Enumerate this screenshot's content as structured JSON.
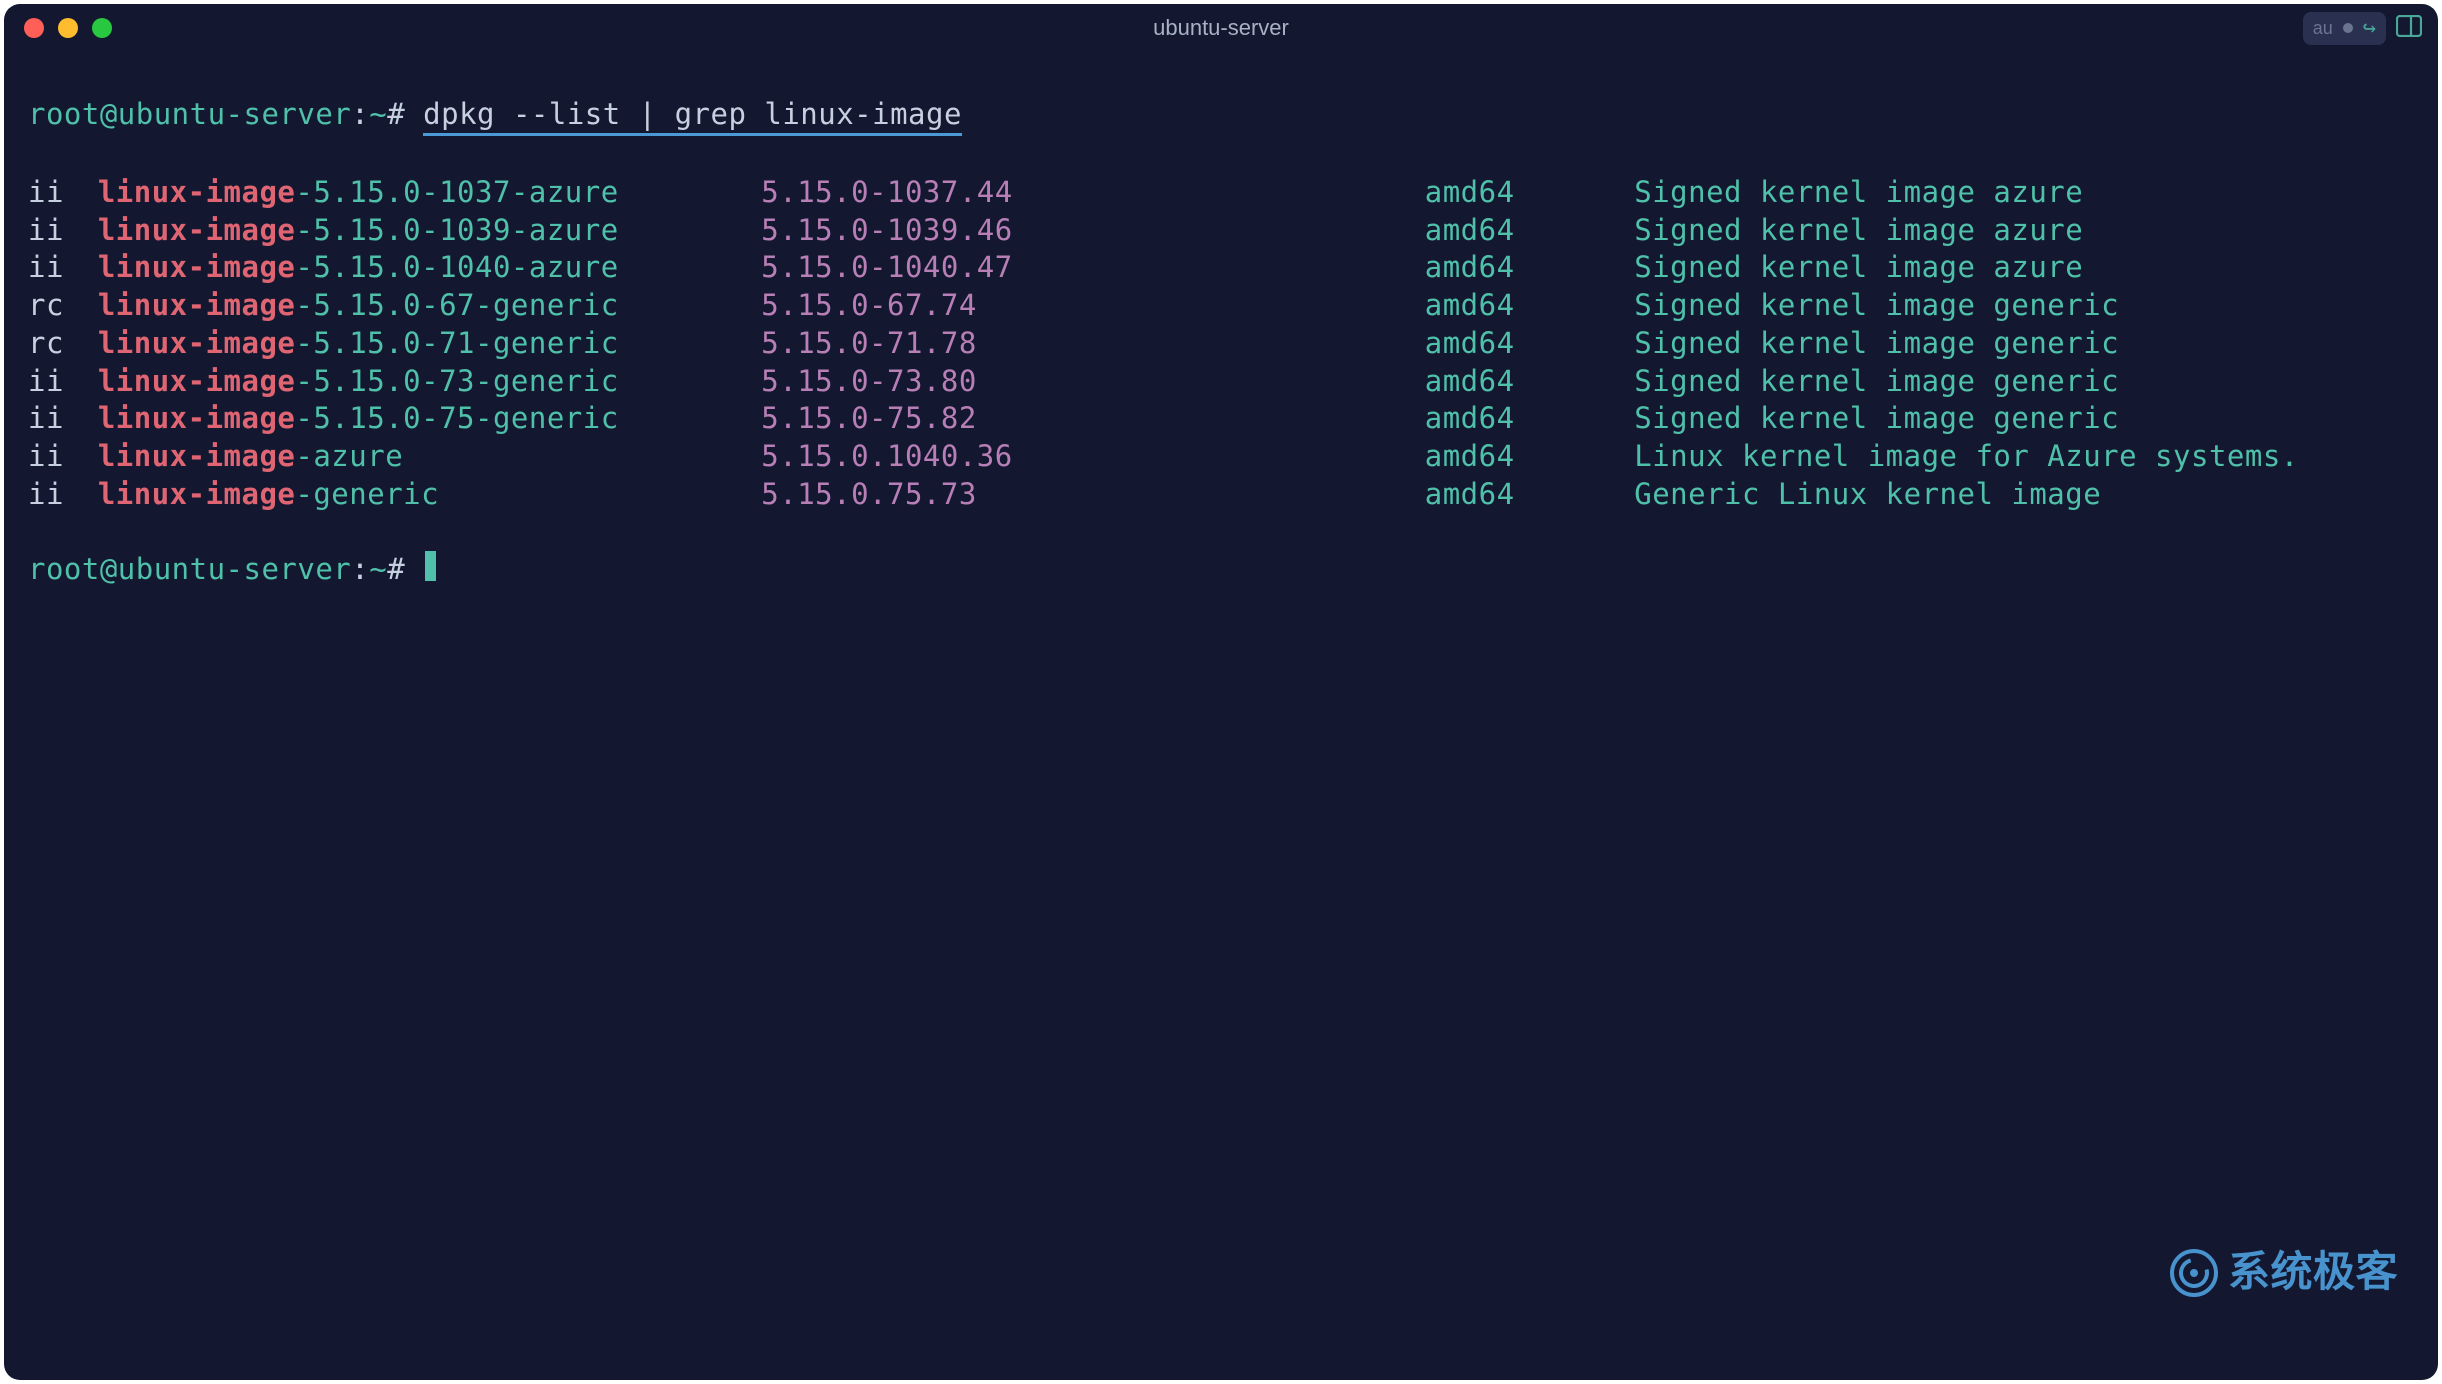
{
  "window": {
    "title": "ubuntu-server",
    "titlebar_right_label": "au"
  },
  "prompt": {
    "user_host": "root@ubuntu-server",
    "sep": ":",
    "path": "~",
    "end": "#"
  },
  "command": {
    "text": "dpkg --list | grep linux-image"
  },
  "rows": [
    {
      "status": "ii",
      "match": "linux-image",
      "rest": "-5.15.0-1037-azure",
      "version": "5.15.0-1037.44",
      "arch": "amd64",
      "desc": "Signed kernel image azure"
    },
    {
      "status": "ii",
      "match": "linux-image",
      "rest": "-5.15.0-1039-azure",
      "version": "5.15.0-1039.46",
      "arch": "amd64",
      "desc": "Signed kernel image azure"
    },
    {
      "status": "ii",
      "match": "linux-image",
      "rest": "-5.15.0-1040-azure",
      "version": "5.15.0-1040.47",
      "arch": "amd64",
      "desc": "Signed kernel image azure"
    },
    {
      "status": "rc",
      "match": "linux-image",
      "rest": "-5.15.0-67-generic",
      "version": "5.15.0-67.74",
      "arch": "amd64",
      "desc": "Signed kernel image generic"
    },
    {
      "status": "rc",
      "match": "linux-image",
      "rest": "-5.15.0-71-generic",
      "version": "5.15.0-71.78",
      "arch": "amd64",
      "desc": "Signed kernel image generic"
    },
    {
      "status": "ii",
      "match": "linux-image",
      "rest": "-5.15.0-73-generic",
      "version": "5.15.0-73.80",
      "arch": "amd64",
      "desc": "Signed kernel image generic"
    },
    {
      "status": "ii",
      "match": "linux-image",
      "rest": "-5.15.0-75-generic",
      "version": "5.15.0-75.82",
      "arch": "amd64",
      "desc": "Signed kernel image generic"
    },
    {
      "status": "ii",
      "match": "linux-image",
      "rest": "-azure",
      "version": "5.15.0.1040.36",
      "arch": "amd64",
      "desc": "Linux kernel image for Azure systems."
    },
    {
      "status": "ii",
      "match": "linux-image",
      "rest": "-generic",
      "version": "5.15.0.75.73",
      "arch": "amd64",
      "desc": "Generic Linux kernel image"
    }
  ],
  "watermark": {
    "text": "系统极客"
  }
}
